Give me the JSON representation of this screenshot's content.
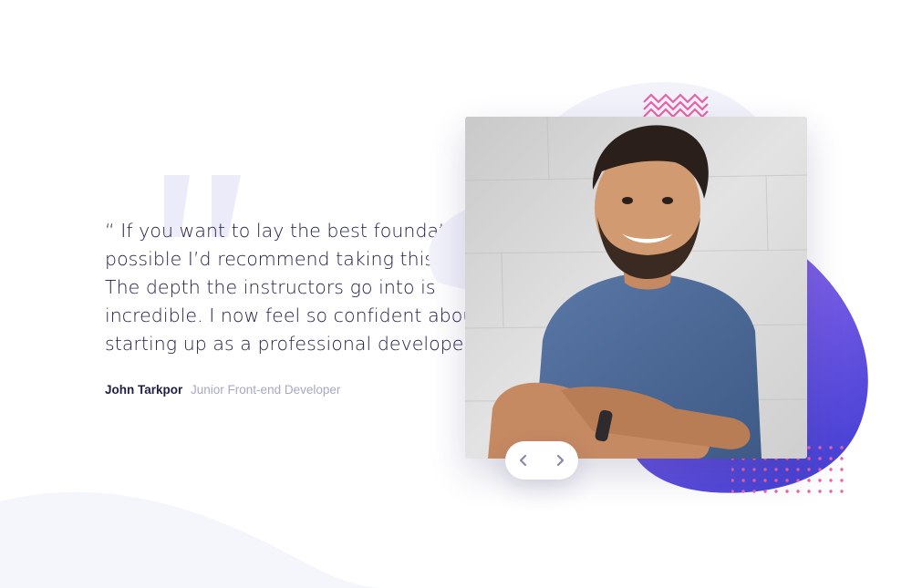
{
  "testimonial": {
    "quote": "“ If you want to lay the best foundation possible I’d recommend taking this course. The depth the instructors go into is incredible. I now feel so confident about starting up as a professional developer. ”",
    "author_name": "John Tarkpor",
    "author_title": "Junior Front-end Developer"
  },
  "photo": {
    "alt": "Portrait of John Tarkpor"
  },
  "slider": {
    "prev_icon": "chevron-left-icon",
    "next_icon": "chevron-right-icon"
  },
  "colors": {
    "text_dark": "#202046",
    "text_muted": "#a8a8c4",
    "quote_mark": "#ebebfa",
    "blob_purple": "#6a52d8",
    "blob_light": "#f2f2fb",
    "pattern_pink": "#ec61a8",
    "icon_gray": "#8a8aa8",
    "background_curve": "#f5f5fc"
  }
}
